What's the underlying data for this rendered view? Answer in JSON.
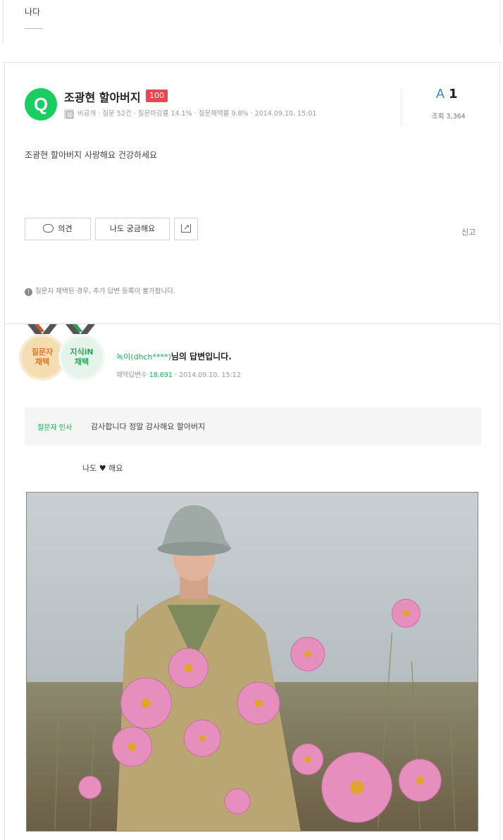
{
  "previous": {
    "text": "나다"
  },
  "question": {
    "author": "조광현 할아버지",
    "level": "100",
    "meta": {
      "privacy": "비공개",
      "questions": "질문 52건",
      "close_rate": "질문마감률 14.1%",
      "adopt_rate": "질문채택률 9.8%",
      "date": "2014.09.10. 15:01"
    },
    "answers": {
      "letter": "A",
      "count": "1"
    },
    "views": "조회 3,364",
    "body": "조광현 할아버지 사랑해요 건강하세요",
    "buttons": {
      "opinion": "의견",
      "metoo": "나도 궁금해요"
    },
    "report": "신고",
    "notice": "질문자 채택된 경우, 추가 답변 등록이 불가합니다."
  },
  "answer": {
    "badges": [
      {
        "line1": "질문자",
        "line2": "채택"
      },
      {
        "line1": "지식iN",
        "line2": "채택"
      }
    ],
    "nickname": "녹이(dhch****)",
    "title_suffix": "님의 답변입니다.",
    "meta": {
      "label": "채택답변수",
      "count": "18,691",
      "date": "2014.09.10. 15:12"
    },
    "thanks": {
      "label": "질문자 인사",
      "text": "감사합니다 정말 감사해요 할아버지"
    },
    "like": {
      "prefix": "나도",
      "heart": "♥",
      "suffix": "해요"
    }
  },
  "colors": {
    "accent_green": "#19ce60",
    "level_red": "#e5484d",
    "answer_blue": "#3b82d6"
  },
  "icons": [
    "q-logo-icon",
    "profile-icon",
    "comment-icon",
    "share-icon",
    "info-icon",
    "heart-icon",
    "medal-ribbon-icon"
  ]
}
